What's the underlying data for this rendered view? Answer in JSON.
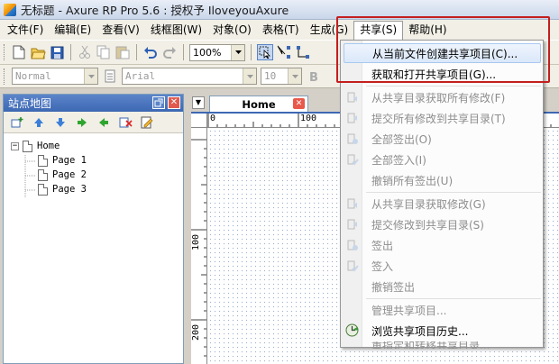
{
  "window": {
    "title": "无标题 - Axure RP Pro 5.6 : 授权予 IloveyouAxure"
  },
  "menubar": {
    "items": [
      "文件(F)",
      "编辑(E)",
      "查看(V)",
      "线框图(W)",
      "对象(O)",
      "表格(T)",
      "生成(G)",
      "共享(S)",
      "帮助(H)"
    ]
  },
  "toolbar": {
    "zoom_value": "100%"
  },
  "format_toolbar": {
    "style_value": "Normal",
    "font_value": "Arial",
    "size_value": "10"
  },
  "sitemap": {
    "title": "站点地图",
    "root": "Home",
    "pages": [
      "Page 1",
      "Page 2",
      "Page 3"
    ]
  },
  "document": {
    "tab_label": "Home",
    "ruler_top": [
      "0",
      "100"
    ],
    "ruler_left": [
      "100",
      "200"
    ]
  },
  "share_menu": {
    "items": [
      {
        "label": "从当前文件创建共享项目(C)...",
        "state": "highlight"
      },
      {
        "label": "获取和打开共享项目(G)...",
        "state": "enabled"
      },
      {
        "label": "从共享目录获取所有修改(F)",
        "state": "disabled"
      },
      {
        "label": "提交所有修改到共享目录(T)",
        "state": "disabled"
      },
      {
        "label": "全部签出(O)",
        "state": "disabled"
      },
      {
        "label": "全部签入(I)",
        "state": "disabled"
      },
      {
        "label": "撤销所有签出(U)",
        "state": "disabled"
      },
      {
        "label": "从共享目录获取修改(G)",
        "state": "disabled"
      },
      {
        "label": "提交修改到共享目录(S)",
        "state": "disabled"
      },
      {
        "label": "签出",
        "state": "disabled"
      },
      {
        "label": "签入",
        "state": "disabled"
      },
      {
        "label": "撤销签出",
        "state": "disabled"
      },
      {
        "label": "管理共享项目...",
        "state": "disabled"
      },
      {
        "label": "浏览共享项目历史...",
        "state": "enabled"
      },
      {
        "label": "重指定和转移共享目录...",
        "state": "disabled"
      }
    ]
  },
  "colors": {
    "highlight_box": "#c41e1e",
    "panel_header": "#3d68b3"
  }
}
